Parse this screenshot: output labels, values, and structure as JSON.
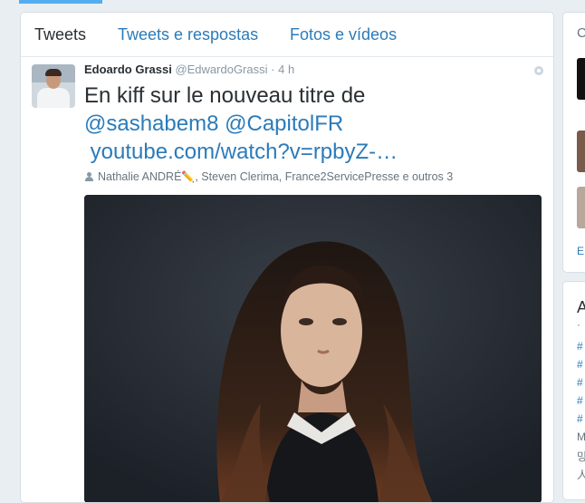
{
  "tabs": [
    {
      "label": "Tweets",
      "active": true
    },
    {
      "label": "Tweets e respostas",
      "active": false
    },
    {
      "label": "Fotos e vídeos",
      "active": false
    }
  ],
  "tweet": {
    "fullname": "Edoardo Grassi",
    "username": "@EdwardoGrassi",
    "separator": "·",
    "time": "4 h",
    "text_plain": "En kiff sur le nouveau titre de",
    "mention1": "@sashabem8",
    "mention2": "@CapitolFR",
    "link": "youtube.com/watch?v=rpbyZ-…",
    "context_people": "Nathalie ANDRÉ",
    "context_rest": ", Steven Clerima, France2ServicePresse e outros 3",
    "pencil_glyph": "✏️"
  },
  "right_column": {
    "top_card_initial": "C",
    "top_card_link": "E",
    "trends_initial": "A",
    "trends_dot": "·",
    "trend_items": [
      "#",
      "#",
      "#",
      "#",
      "#"
    ],
    "trend_muted": [
      "M",
      "밍",
      "人"
    ]
  },
  "colors": {
    "accent": "#2b7bb9",
    "text": "#292f33",
    "muted": "#8899a6",
    "background": "#e9eef2"
  }
}
